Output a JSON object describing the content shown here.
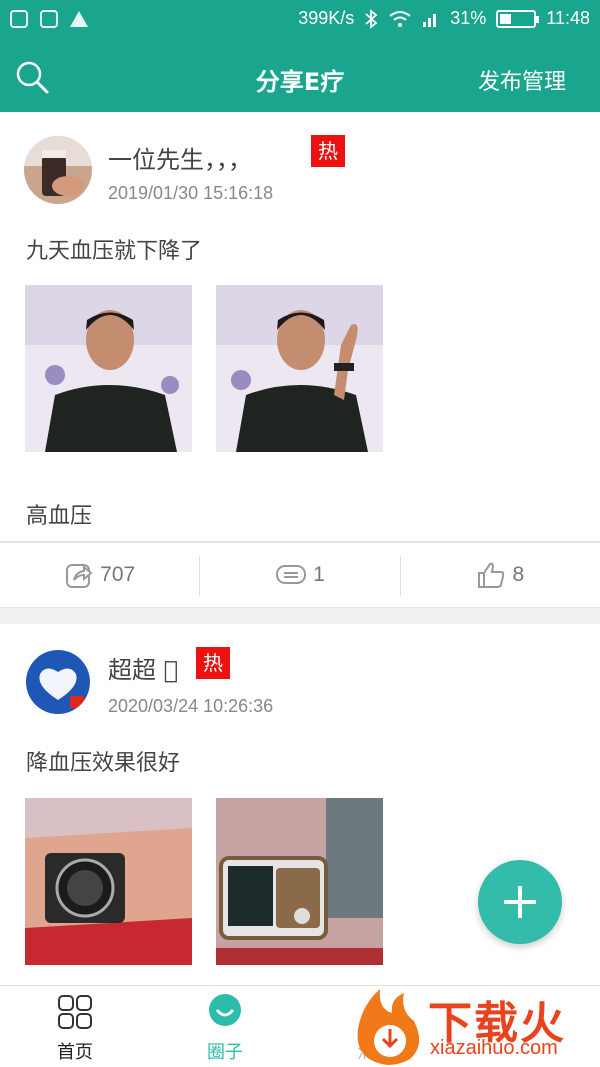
{
  "status_bar": {
    "speed": "399K/s",
    "battery": "31%",
    "time": "11:48"
  },
  "header": {
    "title": "分享E疗",
    "manage_label": "发布管理"
  },
  "posts": [
    {
      "author": "一位先生，，，",
      "hot_badge": "热",
      "time": "2019/01/30 15:16:18",
      "content": "九天血压就下降了",
      "tag": "高血压",
      "shares": "707",
      "comments": "1",
      "likes": "8"
    },
    {
      "author": "超超 􀀀",
      "hot_badge": "热",
      "time": "2020/03/24 10:26:36",
      "content": "降血压效果很好"
    }
  ],
  "tabs": [
    {
      "label": "首页"
    },
    {
      "label": "圈子"
    },
    {
      "label": "消息"
    }
  ],
  "colors": {
    "brand": "#1aa58e",
    "active_tab": "#2bbcaa",
    "hot": "#ee1111"
  },
  "watermark": {
    "text": "下载火",
    "url": "xiazaihuo.com"
  }
}
